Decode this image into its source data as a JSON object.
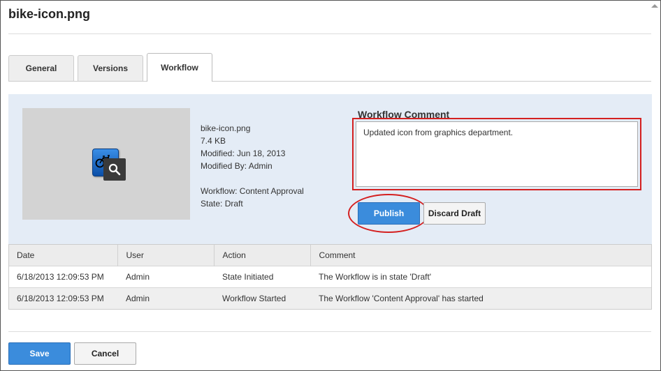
{
  "window": {
    "title": "bike-icon.png"
  },
  "tabs": [
    {
      "label": "General"
    },
    {
      "label": "Versions"
    },
    {
      "label": "Workflow"
    }
  ],
  "active_tab": "Workflow",
  "file_info": {
    "name": "bike-icon.png",
    "size": "7.4 KB",
    "modified": "Modified: Jun 18, 2013",
    "modified_by": "Modified By: Admin",
    "workflow": "Workflow: Content Approval",
    "state": "State: Draft"
  },
  "workflow_comment": {
    "label": "Workflow Comment",
    "value": "Updated icon from graphics department."
  },
  "actions": {
    "publish": "Publish",
    "discard": "Discard Draft"
  },
  "history": {
    "columns": [
      "Date",
      "User",
      "Action",
      "Comment"
    ],
    "rows": [
      {
        "date": "6/18/2013 12:09:53 PM",
        "user": "Admin",
        "action": "State Initiated",
        "comment": "The Workflow is in state 'Draft'"
      },
      {
        "date": "6/18/2013 12:09:53 PM",
        "user": "Admin",
        "action": "Workflow Started",
        "comment": "The Workflow 'Content Approval' has started"
      }
    ]
  },
  "footer": {
    "save": "Save",
    "cancel": "Cancel"
  },
  "icons": {
    "thumbnail": "bike-icon",
    "zoom": "magnifier-icon",
    "scroll": "scroll-up-icon"
  },
  "colors": {
    "primary_button": "#3b8cdc",
    "highlight": "#d42020",
    "panel": "#e4ecf6"
  }
}
